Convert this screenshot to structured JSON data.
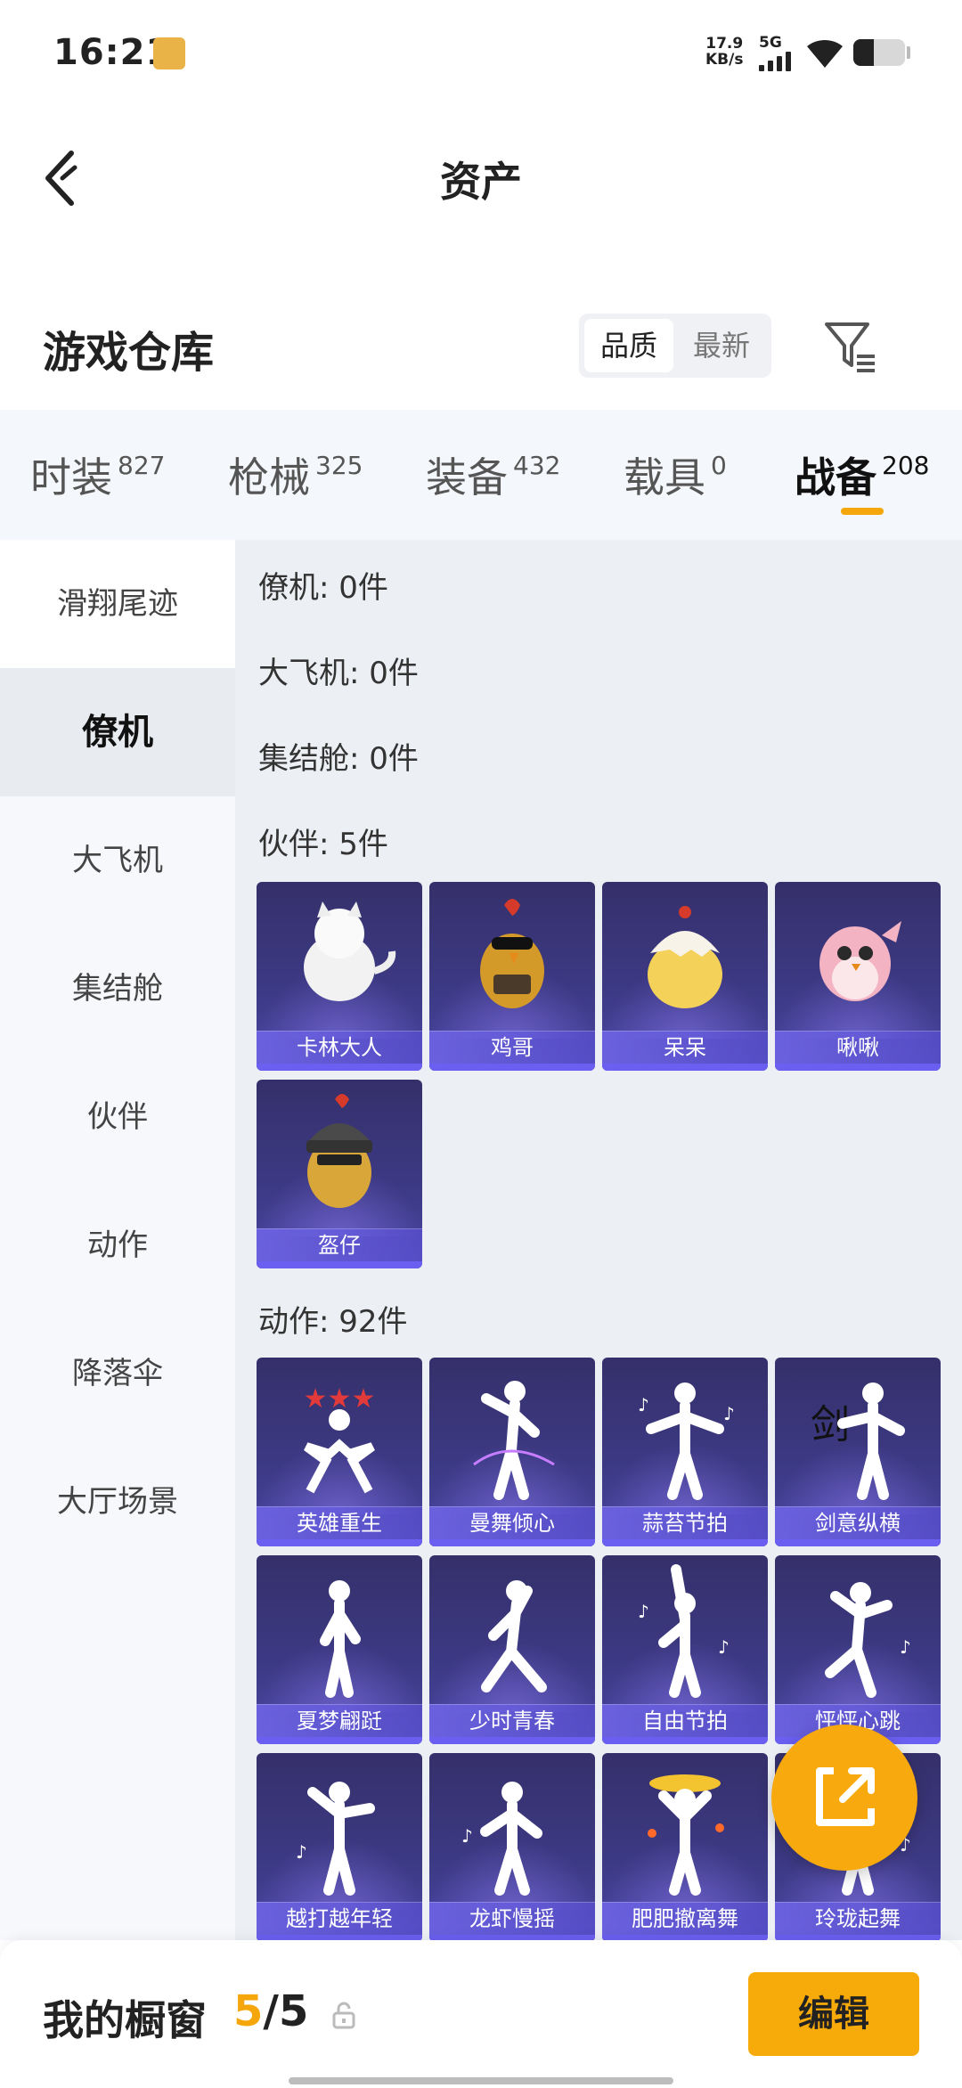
{
  "status_bar": {
    "time": "16:21",
    "net_speed_value": "17.9",
    "net_speed_unit": "KB/s",
    "network": "5G",
    "battery_percent": 40
  },
  "header": {
    "title": "资产"
  },
  "section": {
    "title": "游戏仓库",
    "sort_options": [
      "品质",
      "最新"
    ],
    "active_sort": "品质"
  },
  "tabs": [
    {
      "label": "时装",
      "count": "827"
    },
    {
      "label": "枪械",
      "count": "325"
    },
    {
      "label": "装备",
      "count": "432"
    },
    {
      "label": "载具",
      "count": "0"
    },
    {
      "label": "战备",
      "count": "208",
      "active": true
    }
  ],
  "sidebar": {
    "items": [
      "滑翔尾迹",
      "僚机",
      "大飞机",
      "集结舱",
      "伙伴",
      "动作",
      "降落伞",
      "大厅场景"
    ],
    "active": "僚机"
  },
  "categories": {
    "wingman": "僚机: 0件",
    "plane": "大飞机: 0件",
    "pod": "集结舱: 0件",
    "partner": "伙伴: 5件",
    "emote": "动作: 92件"
  },
  "partners": [
    "卡林大人",
    "鸡哥",
    "呆呆",
    "啾啾",
    "盔仔"
  ],
  "emotes": [
    "英雄重生",
    "曼舞倾心",
    "蒜苔节拍",
    "剑意纵横",
    "夏梦翩跹",
    "少时青春",
    "自由节拍",
    "怦怦心跳",
    "越打越年轻",
    "龙虾慢摇",
    "肥肥撤离舞",
    "玲珑起舞"
  ],
  "bottom_bar": {
    "label": "我的橱窗",
    "count_current": "5",
    "count_total": "/5",
    "edit_label": "编辑"
  },
  "colors": {
    "accent": "#f5a60a",
    "card_bg": "#3d3a86"
  }
}
